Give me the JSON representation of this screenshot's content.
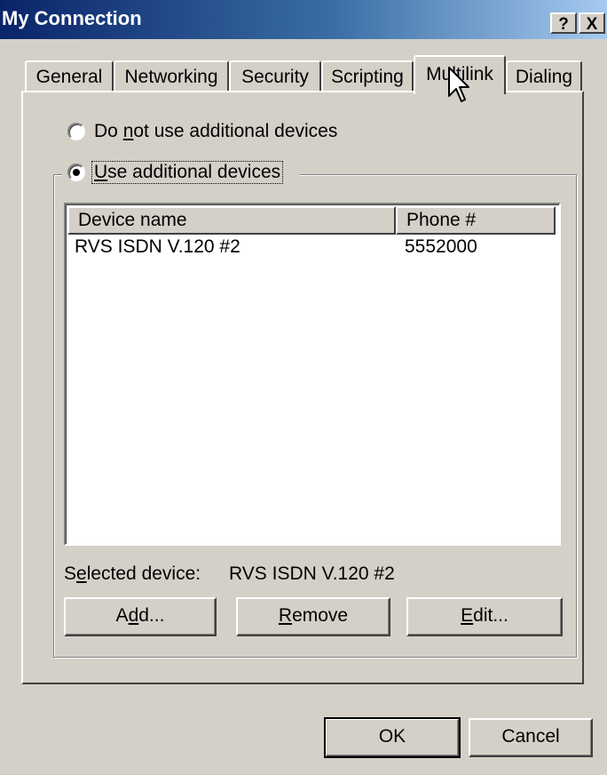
{
  "window": {
    "title": "My Connection",
    "help_glyph": "?",
    "close_glyph": "X"
  },
  "tabs": [
    {
      "label": "General"
    },
    {
      "label": "Networking"
    },
    {
      "label": "Security"
    },
    {
      "label": "Scripting"
    },
    {
      "label": "Multilink",
      "active": true
    },
    {
      "label": "Dialing"
    }
  ],
  "options": {
    "no_additional": {
      "pre": "Do ",
      "accel": "n",
      "post": "ot use additional devices",
      "selected": false
    },
    "use_additional": {
      "pre": "",
      "accel": "U",
      "post": "se additional devices",
      "selected": true
    }
  },
  "devices": {
    "columns": [
      "Device name",
      "Phone #"
    ],
    "rows": [
      {
        "device": "RVS ISDN V.120 #2",
        "phone": "5552000"
      }
    ],
    "selected_label_pre": "S",
    "selected_label_accel": "e",
    "selected_label_post": "lected device:",
    "selected_value": "RVS ISDN V.120 #2"
  },
  "buttons": {
    "add": {
      "pre": "A",
      "accel": "d",
      "post": "d..."
    },
    "remove": {
      "pre": "",
      "accel": "R",
      "post": "emove"
    },
    "edit": {
      "pre": "",
      "accel": "E",
      "post": "dit..."
    },
    "ok": "OK",
    "cancel": "Cancel"
  },
  "colors": {
    "titlebar_start": "#0a246a",
    "titlebar_end": "#a6caf0",
    "face": "#d4d0c8"
  },
  "icons": {
    "cursor": "arrow-cursor-icon"
  }
}
